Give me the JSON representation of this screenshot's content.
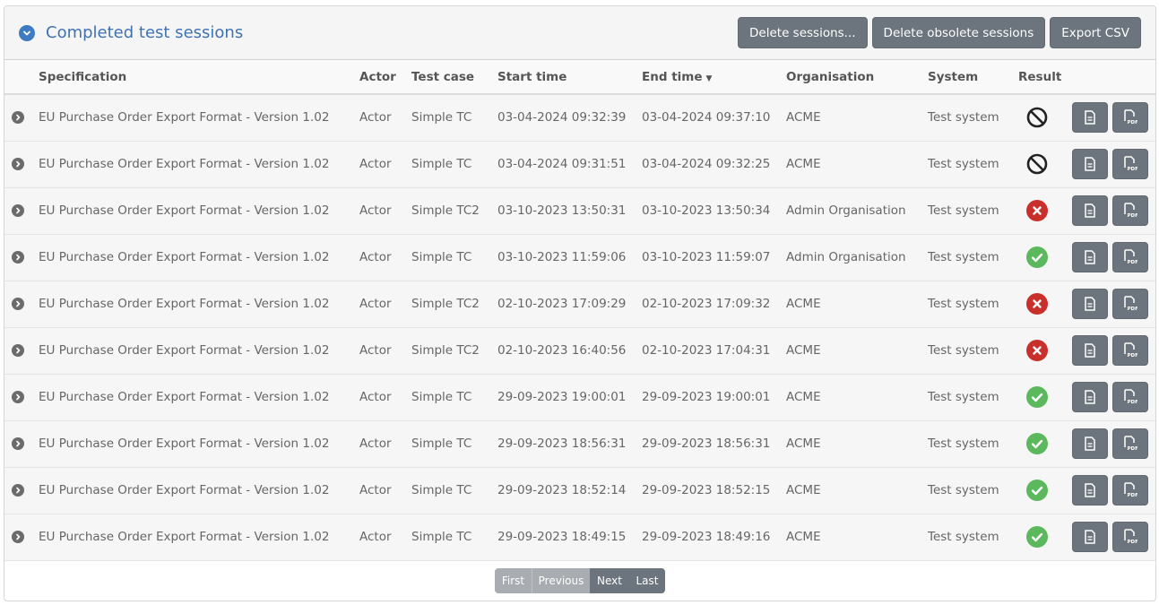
{
  "panel": {
    "title": "Completed test sessions",
    "actions": {
      "delete_sessions": "Delete sessions...",
      "delete_obsolete": "Delete obsolete sessions",
      "export_csv": "Export CSV"
    }
  },
  "table": {
    "columns": {
      "specification": "Specification",
      "actor": "Actor",
      "test_case": "Test case",
      "start_time": "Start time",
      "end_time": "End time",
      "organisation": "Organisation",
      "system": "System",
      "result": "Result"
    },
    "sort_column": "End time",
    "sort_direction": "descending",
    "rows": [
      {
        "specification": "EU Purchase Order Export Format - Version 1.02",
        "actor": "Actor",
        "test_case": "Simple TC",
        "start_time": "03-04-2024 09:32:39",
        "end_time": "03-04-2024 09:37:10",
        "organisation": "ACME",
        "system": "Test system",
        "result": "undefined"
      },
      {
        "specification": "EU Purchase Order Export Format - Version 1.02",
        "actor": "Actor",
        "test_case": "Simple TC",
        "start_time": "03-04-2024 09:31:51",
        "end_time": "03-04-2024 09:32:25",
        "organisation": "ACME",
        "system": "Test system",
        "result": "undefined"
      },
      {
        "specification": "EU Purchase Order Export Format - Version 1.02",
        "actor": "Actor",
        "test_case": "Simple TC2",
        "start_time": "03-10-2023 13:50:31",
        "end_time": "03-10-2023 13:50:34",
        "organisation": "Admin Organisation",
        "system": "Test system",
        "result": "failure"
      },
      {
        "specification": "EU Purchase Order Export Format - Version 1.02",
        "actor": "Actor",
        "test_case": "Simple TC",
        "start_time": "03-10-2023 11:59:06",
        "end_time": "03-10-2023 11:59:07",
        "organisation": "Admin Organisation",
        "system": "Test system",
        "result": "success"
      },
      {
        "specification": "EU Purchase Order Export Format - Version 1.02",
        "actor": "Actor",
        "test_case": "Simple TC2",
        "start_time": "02-10-2023 17:09:29",
        "end_time": "02-10-2023 17:09:32",
        "organisation": "ACME",
        "system": "Test system",
        "result": "failure"
      },
      {
        "specification": "EU Purchase Order Export Format - Version 1.02",
        "actor": "Actor",
        "test_case": "Simple TC2",
        "start_time": "02-10-2023 16:40:56",
        "end_time": "02-10-2023 17:04:31",
        "organisation": "ACME",
        "system": "Test system",
        "result": "failure"
      },
      {
        "specification": "EU Purchase Order Export Format - Version 1.02",
        "actor": "Actor",
        "test_case": "Simple TC",
        "start_time": "29-09-2023 19:00:01",
        "end_time": "29-09-2023 19:00:01",
        "organisation": "ACME",
        "system": "Test system",
        "result": "success"
      },
      {
        "specification": "EU Purchase Order Export Format - Version 1.02",
        "actor": "Actor",
        "test_case": "Simple TC",
        "start_time": "29-09-2023 18:56:31",
        "end_time": "29-09-2023 18:56:31",
        "organisation": "ACME",
        "system": "Test system",
        "result": "success"
      },
      {
        "specification": "EU Purchase Order Export Format - Version 1.02",
        "actor": "Actor",
        "test_case": "Simple TC",
        "start_time": "29-09-2023 18:52:14",
        "end_time": "29-09-2023 18:52:15",
        "organisation": "ACME",
        "system": "Test system",
        "result": "success"
      },
      {
        "specification": "EU Purchase Order Export Format - Version 1.02",
        "actor": "Actor",
        "test_case": "Simple TC",
        "start_time": "29-09-2023 18:49:15",
        "end_time": "29-09-2023 18:49:16",
        "organisation": "ACME",
        "system": "Test system",
        "result": "success"
      }
    ]
  },
  "pagination": {
    "first": "First",
    "previous": "Previous",
    "next": "Next",
    "last": "Last"
  },
  "icons": {
    "collapse": "chevron-down-circle-icon",
    "row_expand": "chevron-right-circle-icon",
    "result_undefined": "ban-icon",
    "result_failure": "x-circle-icon",
    "result_success": "check-circle-icon",
    "report": "document-icon",
    "report_pdf": "pdf-document-icon"
  },
  "colors": {
    "title": "#3f72b1",
    "button": "#6c757d",
    "success": "#5cb85c",
    "failure": "#c9302c",
    "undefined": "#222222"
  }
}
